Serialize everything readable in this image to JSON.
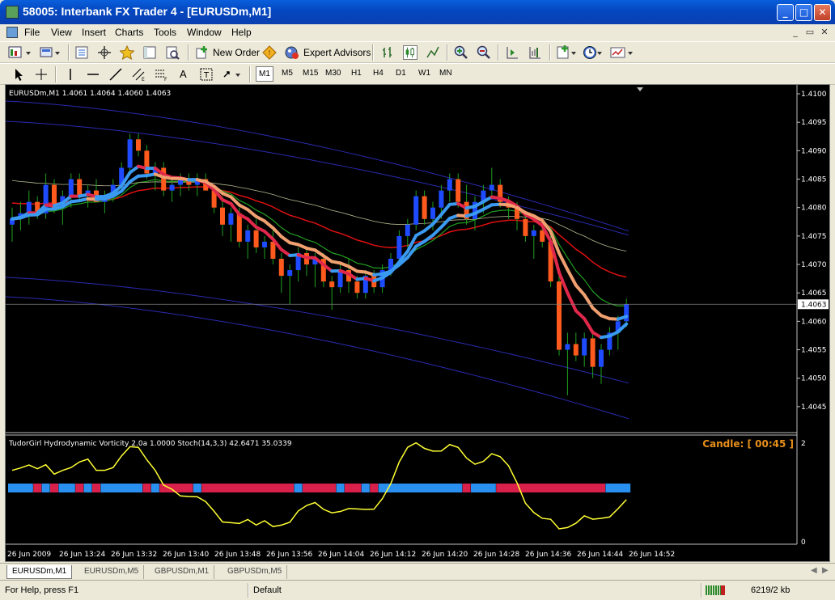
{
  "window": {
    "title": "58005: Interbank FX Trader 4 - [EURUSDm,M1]",
    "controls": [
      "_",
      "□",
      "✕"
    ]
  },
  "menu": {
    "items": [
      "File",
      "View",
      "Insert",
      "Charts",
      "Tools",
      "Window",
      "Help"
    ],
    "mdi_controls": [
      "_",
      "▭",
      "✕"
    ]
  },
  "toolbar": {
    "new_order_label": "New Order",
    "expert_advisors_label": "Expert Advisors",
    "timeframes": [
      "M1",
      "M5",
      "M15",
      "M30",
      "H1",
      "H4",
      "D1",
      "W1",
      "MN"
    ],
    "active_timeframe": "M1",
    "text_tool": "A"
  },
  "chart": {
    "header": "EURUSDm,M1  1.4061 1.4064 1.4060 1.4063",
    "price_labels": [
      "1.4100",
      "1.4095",
      "1.4090",
      "1.4085",
      "1.4080",
      "1.4075",
      "1.4070",
      "1.4065",
      "1.4060",
      "1.4055",
      "1.4050",
      "1.4045"
    ],
    "current_price": "1.4063",
    "indicator_header": "TudorGirl Hydrodynamic Vorticity 2.0a 1.0000  Stoch(14,3,3) 42.6471 35.0339",
    "candle_timer": "Candle: [ 00:45 ]",
    "indicator_scale": [
      "2",
      "0"
    ],
    "time_labels": [
      "26 Jun 2009",
      "26 Jun 13:24",
      "26 Jun 13:32",
      "26 Jun 13:40",
      "26 Jun 13:48",
      "26 Jun 13:56",
      "26 Jun 14:04",
      "26 Jun 14:12",
      "26 Jun 14:20",
      "26 Jun 14:28",
      "26 Jun 14:36",
      "26 Jun 14:44",
      "26 Jun 14:52"
    ],
    "colors": {
      "bull": "#1e4bff",
      "bear": "#ff5a1e",
      "band": "#2a2ab0",
      "fast_up": "#3a9af0",
      "fast_dn": "#e0284a",
      "slow": "#f0a070",
      "ma_red": "#e01010",
      "ma_green": "#20a020",
      "stoch": "#ffff33",
      "bar_up": "#2a90f0",
      "bar_dn": "#d8204a"
    }
  },
  "chart_data": {
    "type": "candlestick",
    "symbol": "EURUSDm",
    "timeframe": "M1",
    "ylim": [
      1.4041,
      1.4101
    ],
    "candles": [
      [
        1.4077,
        1.408,
        1.4074,
        1.4078
      ],
      [
        1.4078,
        1.4081,
        1.4076,
        1.4079
      ],
      [
        1.4079,
        1.4083,
        1.4077,
        1.4081
      ],
      [
        1.4081,
        1.4082,
        1.4078,
        1.4079
      ],
      [
        1.4079,
        1.4086,
        1.4078,
        1.4084
      ],
      [
        1.4084,
        1.4085,
        1.4079,
        1.408
      ],
      [
        1.408,
        1.4083,
        1.4077,
        1.4082
      ],
      [
        1.4082,
        1.4086,
        1.408,
        1.4085
      ],
      [
        1.4085,
        1.4086,
        1.4081,
        1.4082
      ],
      [
        1.4082,
        1.4084,
        1.408,
        1.4083
      ],
      [
        1.4083,
        1.4085,
        1.4081,
        1.4081
      ],
      [
        1.4081,
        1.4083,
        1.4079,
        1.4082
      ],
      [
        1.4082,
        1.4085,
        1.4081,
        1.4084
      ],
      [
        1.4084,
        1.4088,
        1.4083,
        1.4087
      ],
      [
        1.4087,
        1.4093,
        1.4086,
        1.4092
      ],
      [
        1.4092,
        1.4093,
        1.4089,
        1.409
      ],
      [
        1.409,
        1.4091,
        1.4085,
        1.4086
      ],
      [
        1.4086,
        1.4088,
        1.4083,
        1.4087
      ],
      [
        1.4087,
        1.4088,
        1.4082,
        1.4083
      ],
      [
        1.4083,
        1.4085,
        1.4081,
        1.4084
      ],
      [
        1.4084,
        1.4086,
        1.4082,
        1.4085
      ],
      [
        1.4085,
        1.4086,
        1.4083,
        1.4084
      ],
      [
        1.4084,
        1.4086,
        1.4082,
        1.4085
      ],
      [
        1.4085,
        1.4086,
        1.4083,
        1.4083
      ],
      [
        1.4083,
        1.4084,
        1.4079,
        1.408
      ],
      [
        1.408,
        1.4082,
        1.4075,
        1.4077
      ],
      [
        1.4077,
        1.408,
        1.4074,
        1.4079
      ],
      [
        1.4079,
        1.408,
        1.4073,
        1.4074
      ],
      [
        1.4074,
        1.4077,
        1.4071,
        1.4076
      ],
      [
        1.4076,
        1.4078,
        1.4072,
        1.4073
      ],
      [
        1.4073,
        1.4075,
        1.4071,
        1.4074
      ],
      [
        1.4074,
        1.4076,
        1.407,
        1.4071
      ],
      [
        1.4071,
        1.4072,
        1.4065,
        1.4068
      ],
      [
        1.4068,
        1.407,
        1.4063,
        1.4069
      ],
      [
        1.4069,
        1.4073,
        1.4067,
        1.4072
      ],
      [
        1.4072,
        1.4073,
        1.4068,
        1.407
      ],
      [
        1.407,
        1.4072,
        1.4066,
        1.4071
      ],
      [
        1.4071,
        1.4072,
        1.4066,
        1.4067
      ],
      [
        1.4067,
        1.4068,
        1.4062,
        1.4066
      ],
      [
        1.4066,
        1.407,
        1.4065,
        1.4069
      ],
      [
        1.4069,
        1.4071,
        1.4065,
        1.4067
      ],
      [
        1.4067,
        1.4068,
        1.4064,
        1.4065
      ],
      [
        1.4065,
        1.4069,
        1.4064,
        1.4068
      ],
      [
        1.4068,
        1.4069,
        1.4065,
        1.4066
      ],
      [
        1.4066,
        1.407,
        1.4065,
        1.4069
      ],
      [
        1.4069,
        1.4072,
        1.4068,
        1.4071
      ],
      [
        1.4071,
        1.4076,
        1.407,
        1.4075
      ],
      [
        1.4075,
        1.4078,
        1.4073,
        1.4077
      ],
      [
        1.4077,
        1.4083,
        1.4076,
        1.4082
      ],
      [
        1.4082,
        1.4083,
        1.4077,
        1.4078
      ],
      [
        1.4078,
        1.4081,
        1.4076,
        1.408
      ],
      [
        1.408,
        1.4084,
        1.4078,
        1.4083
      ],
      [
        1.4083,
        1.4086,
        1.4081,
        1.4085
      ],
      [
        1.4085,
        1.4086,
        1.408,
        1.4081
      ],
      [
        1.4081,
        1.4084,
        1.4077,
        1.4078
      ],
      [
        1.4078,
        1.4082,
        1.4076,
        1.4081
      ],
      [
        1.4081,
        1.4084,
        1.4079,
        1.4083
      ],
      [
        1.4083,
        1.4087,
        1.4082,
        1.4084
      ],
      [
        1.4084,
        1.4085,
        1.408,
        1.4081
      ],
      [
        1.4081,
        1.4082,
        1.4078,
        1.408
      ],
      [
        1.408,
        1.4081,
        1.4076,
        1.4078
      ],
      [
        1.4078,
        1.4079,
        1.4074,
        1.4075
      ],
      [
        1.4075,
        1.4077,
        1.4071,
        1.4076
      ],
      [
        1.4076,
        1.4077,
        1.4073,
        1.4074
      ],
      [
        1.4074,
        1.4075,
        1.4066,
        1.4067
      ],
      [
        1.4067,
        1.4068,
        1.4054,
        1.4055
      ],
      [
        1.4055,
        1.4058,
        1.4047,
        1.4056
      ],
      [
        1.4056,
        1.4058,
        1.4053,
        1.4054
      ],
      [
        1.4054,
        1.4058,
        1.4052,
        1.4057
      ],
      [
        1.4057,
        1.4058,
        1.405,
        1.4052
      ],
      [
        1.4052,
        1.4056,
        1.4049,
        1.4055
      ],
      [
        1.4055,
        1.4059,
        1.4054,
        1.4058
      ],
      [
        1.4058,
        1.4061,
        1.4055,
        1.406
      ],
      [
        1.406,
        1.4064,
        1.4059,
        1.4063
      ]
    ],
    "stochastic": {
      "name": "Stoch(14,3,3)",
      "main": 42.6471,
      "signal": 35.0339
    }
  }
}
